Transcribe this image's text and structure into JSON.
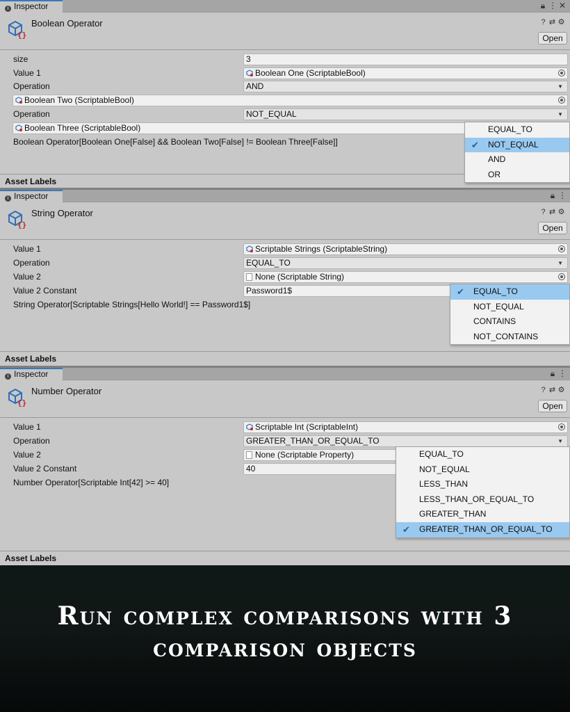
{
  "tabs": {
    "inspector_label": "Inspector"
  },
  "header_buttons": {
    "open_label": "Open"
  },
  "asset_labels": "Asset Labels",
  "panels": [
    {
      "title": "Boolean Operator",
      "rows": [
        {
          "label": "size",
          "value": "3"
        },
        {
          "label": "Value 1",
          "value": "Boolean One (ScriptableBool)"
        },
        {
          "label": "Operation",
          "value": "AND"
        },
        {
          "label": "",
          "value": "Boolean Two (ScriptableBool)"
        },
        {
          "label": "Operation",
          "value": "NOT_EQUAL"
        },
        {
          "label": "",
          "value": "Boolean Three (ScriptableBool)"
        }
      ],
      "result": "Boolean Operator[Boolean One[False] && Boolean Two[False] != Boolean Three[False]]",
      "menu": {
        "items": [
          "EQUAL_TO",
          "NOT_EQUAL",
          "AND",
          "OR"
        ],
        "selected": "NOT_EQUAL"
      }
    },
    {
      "title": "String Operator",
      "rows": [
        {
          "label": "Value 1",
          "value": "Scriptable Strings (ScriptableString)"
        },
        {
          "label": "Operation",
          "value": "EQUAL_TO"
        },
        {
          "label": "Value 2",
          "value": "None (Scriptable String)"
        },
        {
          "label": "Value 2 Constant",
          "value": "Password1$"
        }
      ],
      "result": "String Operator[Scriptable Strings[Hello World!] == Password1$]",
      "menu": {
        "items": [
          "EQUAL_TO",
          "NOT_EQUAL",
          "CONTAINS",
          "NOT_CONTAINS"
        ],
        "selected": "EQUAL_TO"
      }
    },
    {
      "title": "Number Operator",
      "rows": [
        {
          "label": "Value 1",
          "value": "Scriptable Int (ScriptableInt)"
        },
        {
          "label": "Operation",
          "value": "GREATER_THAN_OR_EQUAL_TO"
        },
        {
          "label": "Value 2",
          "value": "None (Scriptable Property)"
        },
        {
          "label": "Value 2 Constant",
          "value": "40"
        }
      ],
      "result": "Number Operator[Scriptable Int[42] >= 40]",
      "menu": {
        "items": [
          "EQUAL_TO",
          "NOT_EQUAL",
          "LESS_THAN",
          "LESS_THAN_OR_EQUAL_TO",
          "GREATER_THAN",
          "GREATER_THAN_OR_EQUAL_TO"
        ],
        "selected": "GREATER_THAN_OR_EQUAL_TO"
      }
    }
  ],
  "banner": {
    "line1": "Run complex comparisons with 3",
    "line2": "comparison objects"
  },
  "colors": {
    "accent": "#3a79bb",
    "selection": "#99c9ef",
    "panel_bg": "#c8c8c8"
  }
}
